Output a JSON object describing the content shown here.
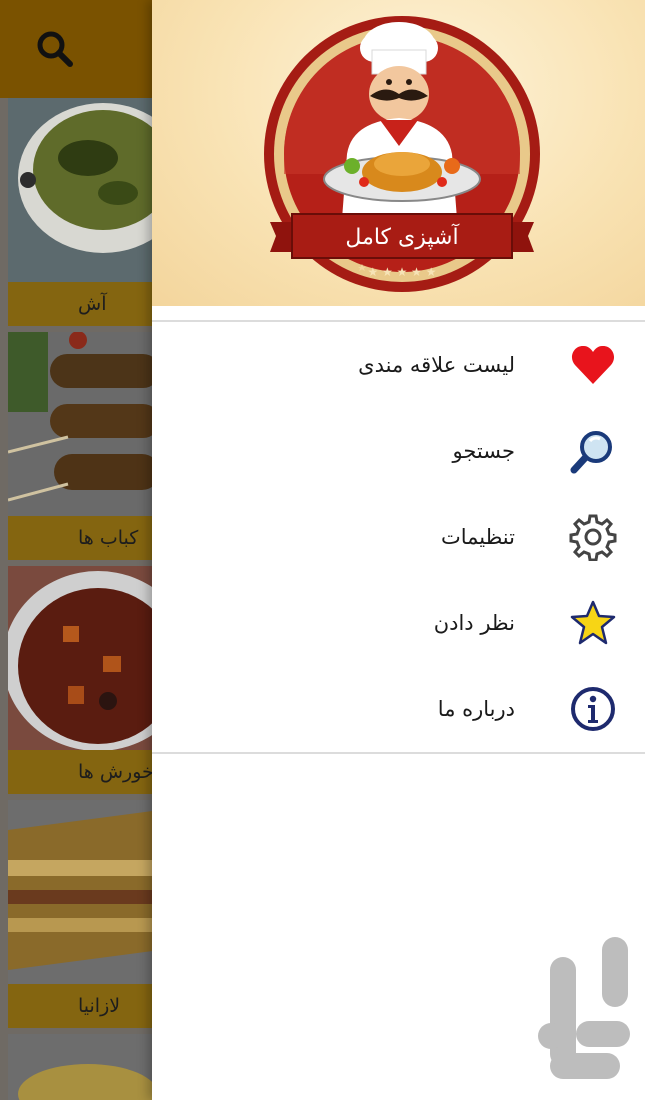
{
  "app": {
    "logo_text": "آشپزی کامل"
  },
  "background": {
    "categories": [
      {
        "label": "آش"
      },
      {
        "label": "کباب ها"
      },
      {
        "label": "خورش ها"
      },
      {
        "label": "لازانیا"
      }
    ]
  },
  "drawer": {
    "menu": [
      {
        "label": "لیست علاقه مندی",
        "icon": "heart-icon",
        "color": "#e8141c"
      },
      {
        "label": "جستجو",
        "icon": "search-icon",
        "color": "#1a3a7a"
      },
      {
        "label": "تنظیمات",
        "icon": "gear-icon",
        "color": "#444444"
      },
      {
        "label": "نظر دادن",
        "icon": "star-icon",
        "color": "#f7d515"
      },
      {
        "label": "درباره ما",
        "icon": "info-icon",
        "color": "#1e2a6e"
      }
    ]
  },
  "colors": {
    "toolbar": "#7a5200",
    "label_bar": "#846510",
    "header_bg": "#f9e3b4"
  }
}
